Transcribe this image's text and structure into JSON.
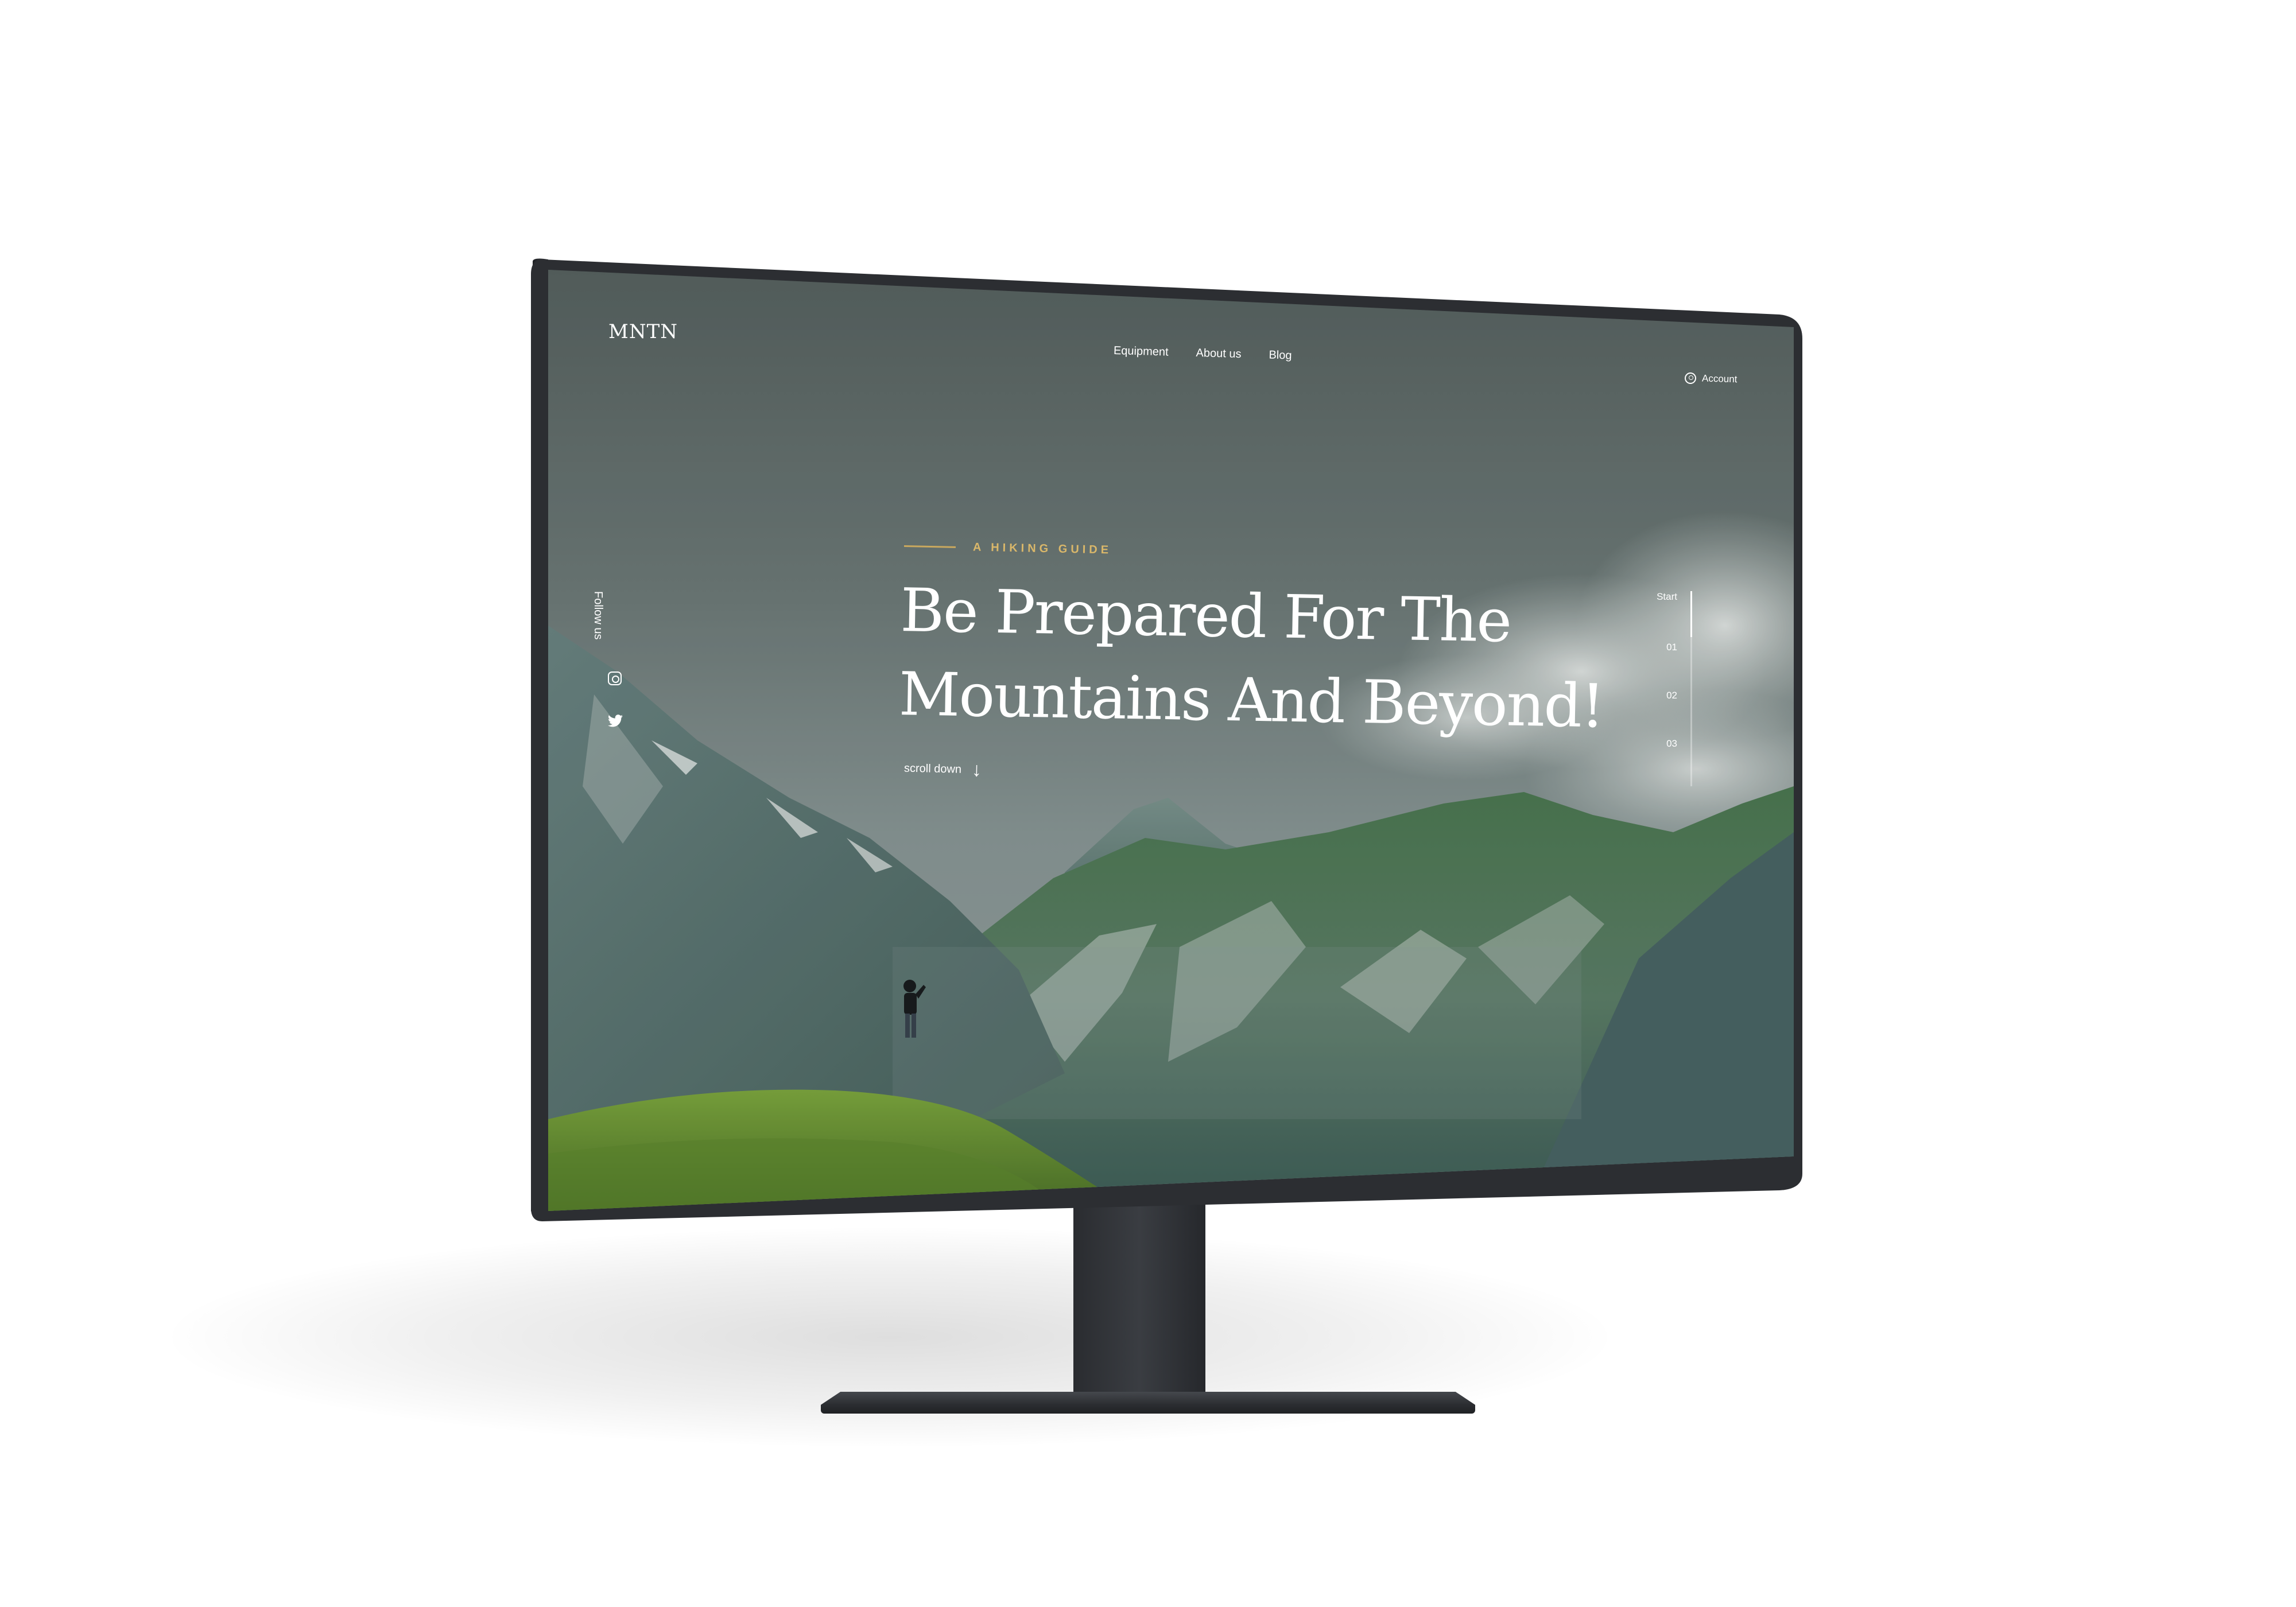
{
  "site": {
    "logo": "MNTN",
    "nav": [
      {
        "label": "Equipment"
      },
      {
        "label": "About us"
      },
      {
        "label": "Blog"
      }
    ],
    "account_label": "Account"
  },
  "side": {
    "follow_label": "Follow us",
    "icons": [
      "instagram-icon",
      "twitter-icon"
    ]
  },
  "hero": {
    "eyebrow": "A HIKING GUIDE",
    "headline_line1": "Be Prepared For The",
    "headline_line2": "Mountains And Beyond!",
    "scroll_label": "scroll down"
  },
  "slider": {
    "items": [
      {
        "label": "Start"
      },
      {
        "label": "01"
      },
      {
        "label": "02"
      },
      {
        "label": "03"
      }
    ],
    "active_index": 0
  },
  "colors": {
    "accent_gold": "#d9b76a",
    "monitor_bezel": "#2c2e32",
    "sky_top": "#5a6563",
    "grass": "#6f9a3a"
  }
}
